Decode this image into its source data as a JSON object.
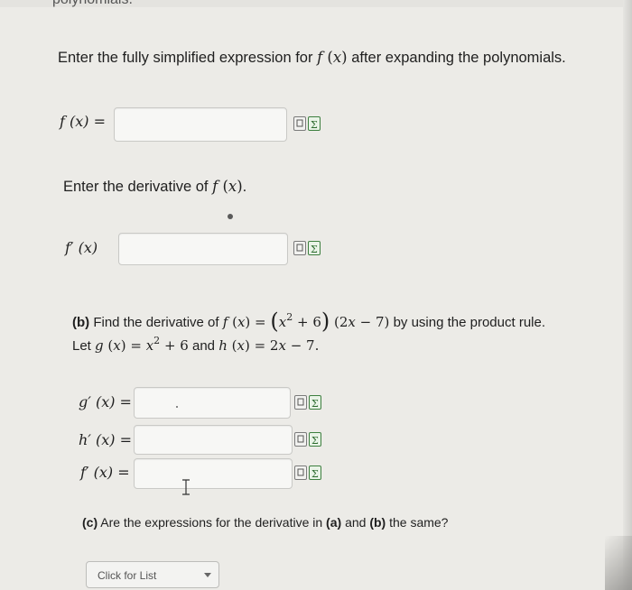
{
  "header_fragment": "polynomials.",
  "part_a": {
    "prompt": "Enter the fully simplified expression for f (x) after expanding the polynomials.",
    "prompt_pre": "Enter the fully simplified expression for",
    "prompt_post": "after expanding the polynomials.",
    "f_label": "f (x) =",
    "f_value": "",
    "derivative_prompt_pre": "Enter the derivative of",
    "derivative_prompt_post": ".",
    "fprime_label": "f′ (x)",
    "fprime_value": ""
  },
  "part_b": {
    "tag": "(b)",
    "line1_pre": "Find the derivative of",
    "line1_expr": "f (x) = (x² + 6) (2x − 7)",
    "line1_post": "by using the product rule.",
    "line2_pre": "Let",
    "line2_g": "g (x) = x² + 6",
    "line2_and": "and",
    "line2_h": "h (x) = 2x − 7.",
    "gprime_label": "g′ (x) =",
    "hprime_label": "h′ (x) =",
    "fprime_label": "f′ (x) =",
    "gprime_value": "",
    "hprime_value": "",
    "fprime_value": ""
  },
  "part_c": {
    "tag": "(c)",
    "question_pre": "Are the expressions for the derivative in",
    "a_ref": "(a)",
    "and": "and",
    "b_ref": "(b)",
    "question_post": "the same?",
    "select_value": "Click for List"
  },
  "icons": {
    "preview": "preview-icon",
    "sigma": "sigma-icon"
  }
}
